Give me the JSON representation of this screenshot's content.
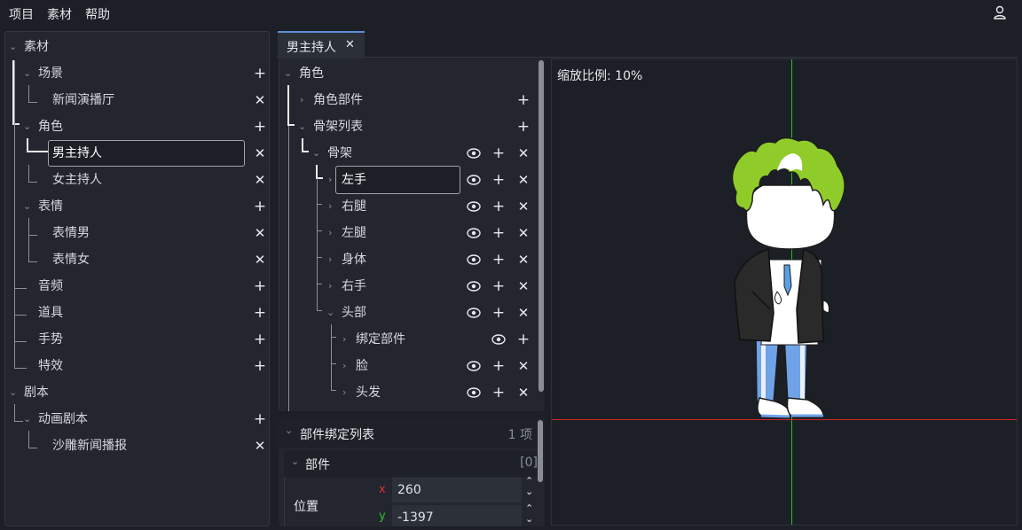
{
  "menu": {
    "project": "项目",
    "assets": "素材",
    "help": "帮助"
  },
  "left_tree": {
    "root_assets": "素材",
    "scene": "场景",
    "scene_item": "新闻演播厅",
    "role": "角色",
    "role_male": "男主持人",
    "role_female": "女主持人",
    "expression": "表情",
    "expr_male": "表情男",
    "expr_female": "表情女",
    "audio": "音频",
    "props": "道具",
    "gesture": "手势",
    "effects": "特效",
    "root_script": "剧本",
    "anim_script": "动画剧本",
    "anim_item": "沙雕新闻播报"
  },
  "tab": {
    "label": "男主持人",
    "close": "✕"
  },
  "role_tree": {
    "role": "角色",
    "parts": "角色部件",
    "skeleton_list": "骨架列表",
    "skeleton": "骨架",
    "bones": [
      "左手",
      "右腿",
      "左腿",
      "身体",
      "右手",
      "头部"
    ],
    "head_children": [
      "绑定部件",
      "脸",
      "头发"
    ]
  },
  "binding": {
    "title": "部件绑定列表",
    "count": "1 项",
    "part_header": "部件",
    "index": "[0]",
    "position_label": "位置",
    "x_label": "x",
    "x_value": "260",
    "y_label": "y",
    "y_value": "-1397"
  },
  "canvas": {
    "scale_label": "缩放比例: 10%"
  },
  "icons": {
    "add": "+",
    "remove": "✕",
    "expand": "›",
    "collapse": "⌄"
  },
  "colors": {
    "accent": "#5b8fd6",
    "x_axis": "#d02525",
    "y_axis": "#22c322",
    "hair": "#8fcc2a"
  }
}
